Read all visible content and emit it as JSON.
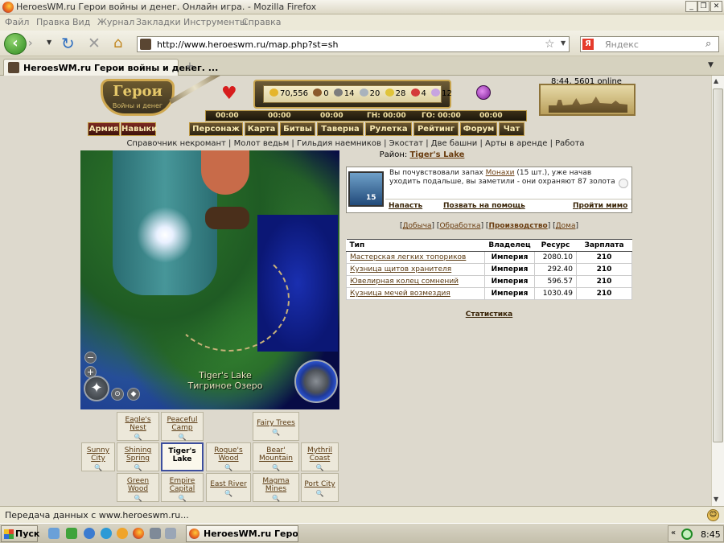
{
  "window": {
    "title": "HeroesWM.ru Герои войны и денег. Онлайн игра. - Mozilla Firefox"
  },
  "menu": [
    "Файл",
    "Правка",
    "Вид",
    "Журнал",
    "Закладки",
    "Инструменты",
    "Справка"
  ],
  "address": {
    "url": "http://www.heroeswm.ru/map.php?st=sh"
  },
  "search": {
    "placeholder": "Яндекс",
    "engine_label": "Я"
  },
  "tab": {
    "title": "HeroesWM.ru Герои войны и денег. ..."
  },
  "game": {
    "logo_title": "Герои",
    "logo_sub": "Войны и денег",
    "online": "8:44, 5601 online",
    "resources": {
      "gold": "70,556",
      "wood": "0",
      "ore": "14",
      "mercury": "20",
      "sulfur": "28",
      "crystal": "4",
      "gems": "12"
    },
    "timers": [
      "00:00",
      "00:00",
      "00:00",
      "ГН: 00:00",
      "ГО: 00:00",
      "00:00"
    ],
    "nav_left": [
      "Армия",
      "Навыки"
    ],
    "nav": [
      "Персонаж",
      "Карта",
      "Битвы",
      "Таверна",
      "Рулетка",
      "Рейтинг",
      "Форум",
      "Чат"
    ],
    "links": "Справочник некромант | Молот ведьм | Гильдия наемников | Экостат | Две башни | Арты в аренде | Работа",
    "district_label": "Район:",
    "district": "Tiger's Lake",
    "map_label_en": "Tiger's Lake",
    "map_label_ru": "Тигриное Озеро",
    "grid": [
      {
        "name": "Eagle's Nest"
      },
      {
        "name": "Peaceful Camp"
      },
      {
        "name": "Fairy Trees"
      },
      {
        "name": "Sunny City"
      },
      {
        "name": "Shining Spring"
      },
      {
        "name": "Tiger's Lake",
        "current": true
      },
      {
        "name": "Rogue's Wood"
      },
      {
        "name": "Bear' Mountain"
      },
      {
        "name": "Mythril Coast"
      },
      {
        "name": "Green Wood"
      },
      {
        "name": "Empire Capital"
      },
      {
        "name": "East River"
      },
      {
        "name": "Magma Mines"
      },
      {
        "name": "Port City"
      }
    ],
    "encounter": {
      "avatar_count": "15",
      "text_before": "Вы почувствовали запах",
      "monster": "Монахи",
      "text_after": "(15 шт.), уже начав уходить подальше, вы заметили - они охраняют 87 золота",
      "attack": "Напасть",
      "call_help": "Позвать на помощь",
      "pass_by": "Пройти мимо"
    },
    "filters": {
      "mining": "Добыча",
      "processing": "Обработка",
      "production": "Производство",
      "houses": "Дома"
    },
    "table": {
      "headers": [
        "Тип",
        "Владелец",
        "Ресурс",
        "Зарплата"
      ],
      "rows": [
        [
          "Мастерская легких топориков",
          "Империя",
          "2080.10",
          "210"
        ],
        [
          "Кузница щитов хранителя",
          "Империя",
          "292.40",
          "210"
        ],
        [
          "Ювелирная колец сомнений",
          "Империя",
          "596.57",
          "210"
        ],
        [
          "Кузница мечей возмездия",
          "Империя",
          "1030.49",
          "210"
        ]
      ]
    },
    "stats": "Статистика"
  },
  "status": {
    "text": "Передача данных с www.heroeswm.ru..."
  },
  "taskbar": {
    "start": "Пуск",
    "task": "HeroesWM.ru Герои в...",
    "clock": "8:45",
    "chevron": "«"
  },
  "colors": {
    "accent": "#c7a44e",
    "link": "#6a3d10",
    "map_water": "#0b1775"
  }
}
